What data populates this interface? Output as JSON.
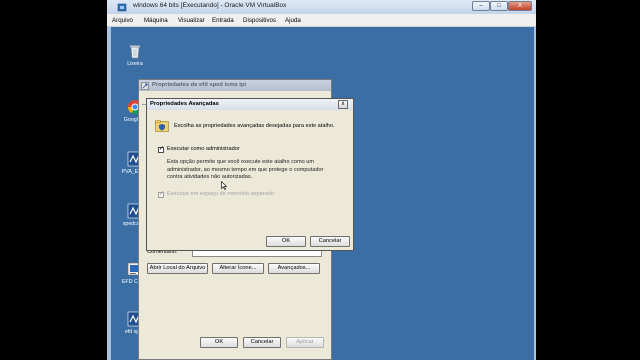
{
  "window": {
    "title": "windows 64 bits [Executando] - Oracle VM VirtualBox",
    "controls": {
      "minimize": "–",
      "maximize": "□",
      "close": "X"
    }
  },
  "menubar": {
    "items": [
      "Arquivo",
      "Máquina",
      "Visualizar",
      "Entrada",
      "Dispositivos",
      "Ajuda"
    ]
  },
  "desktop": {
    "icons": [
      {
        "label": "Lixeira",
        "icon": "recycle-bin-icon"
      },
      {
        "label": "Google C",
        "icon": "chrome-icon"
      },
      {
        "label": "PVA_EFD_",
        "icon": "efd-app-icon"
      },
      {
        "label": "spedcontri",
        "icon": "sped-icon"
      },
      {
        "label": "EFD Contri",
        "icon": "efd-contrib-icon"
      },
      {
        "label": "efd sped",
        "icon": "efd-sped-icon"
      }
    ]
  },
  "props_dialog": {
    "title": "Propriedades de efd sped icms ipi",
    "comment_label": "Comentário:",
    "open_location": "Abrir Local do Arquivo",
    "change_icon": "Alterar Ícone...",
    "advanced": "Avançados...",
    "ok": "OK",
    "cancel": "Cancelar",
    "apply": "Aplicar"
  },
  "advanced_dialog": {
    "title": "Propriedades Avançadas",
    "close": "x",
    "intro": "Escolha as propriedades avançadas desejadas para este atalho.",
    "run_as_admin": "Executar como administrador",
    "description_lines": [
      "Esta opção permite que você execute este atalho como um",
      "administrador, ao mesmo tempo em que protege o computador",
      "contra atividades não autorizadas."
    ],
    "separate_memory": "Executar em espaço de memória separado",
    "ok": "OK",
    "cancel": "Cancelar"
  }
}
